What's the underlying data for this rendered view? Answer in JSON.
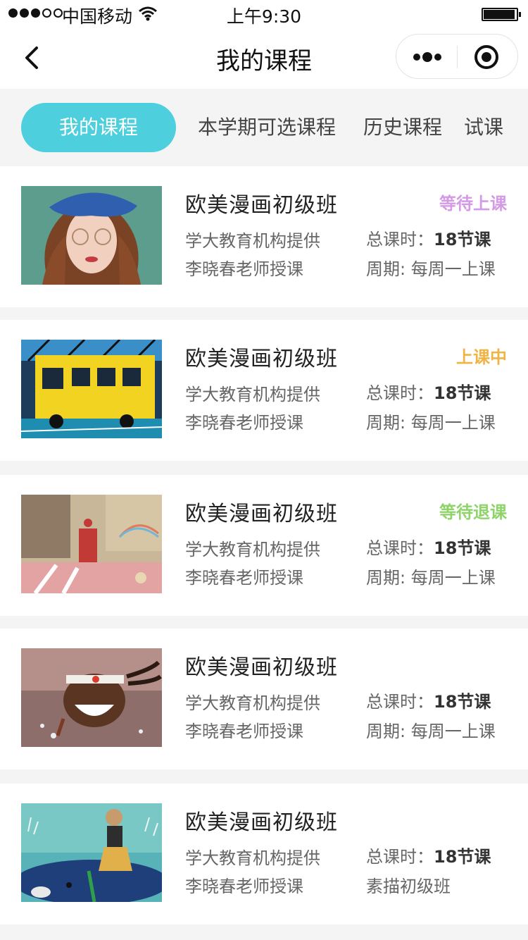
{
  "status_bar": {
    "carrier": "中国移动",
    "time": "上午9:30"
  },
  "nav": {
    "title": "我的课程",
    "back_icon": "chevron-left-icon",
    "more_icon": "more-dots-icon",
    "close_icon": "target-close-icon"
  },
  "tabs": [
    {
      "label": "我的课程",
      "active": true
    },
    {
      "label": "本学期可选课程",
      "active": false
    },
    {
      "label": "历史课程",
      "active": false
    },
    {
      "label": "试课",
      "active": false
    }
  ],
  "colors": {
    "accent": "#4dcfdd",
    "status_waiting": "#d59ae6",
    "status_in_class": "#f0b445",
    "status_waiting_withdraw": "#8ed46a"
  },
  "courses": [
    {
      "title": "欧美漫画初级班",
      "provider": "学大教育机构提供",
      "teacher": "李晓春老师授课",
      "hours_label": "总课时：",
      "hours_value": "18节课",
      "period": "周期: 每周一上课",
      "status": "等待上课",
      "status_color": "#d59ae6",
      "image": "illustration-girl-beret"
    },
    {
      "title": "欧美漫画初级班",
      "provider": "学大教育机构提供",
      "teacher": "李晓春老师授课",
      "hours_label": "总课时：",
      "hours_value": "18节课",
      "period": "周期: 每周一上课",
      "status": "上课中",
      "status_color": "#f0b445",
      "image": "illustration-yellow-train"
    },
    {
      "title": "欧美漫画初级班",
      "provider": "学大教育机构提供",
      "teacher": "李晓春老师授课",
      "hours_label": "总课时：",
      "hours_value": "18节课",
      "period": "周期: 每周一上课",
      "status": "等待退课",
      "status_color": "#8ed46a",
      "image": "illustration-street-scene"
    },
    {
      "title": "欧美漫画初级班",
      "provider": "学大教育机构提供",
      "teacher": "李晓春老师授课",
      "hours_label": "总课时：",
      "hours_value": "18节课",
      "period": "周期: 每周一上课",
      "status": "",
      "status_color": "#333333",
      "image": "illustration-laughing-boy"
    },
    {
      "title": "欧美漫画初级班",
      "provider": "学大教育机构提供",
      "teacher": "李晓春老师授课",
      "hours_label": "总课时：",
      "hours_value": "18节课",
      "period": "素描初级班",
      "status": "",
      "status_color": "#333333",
      "image": "illustration-whale-girl"
    }
  ]
}
